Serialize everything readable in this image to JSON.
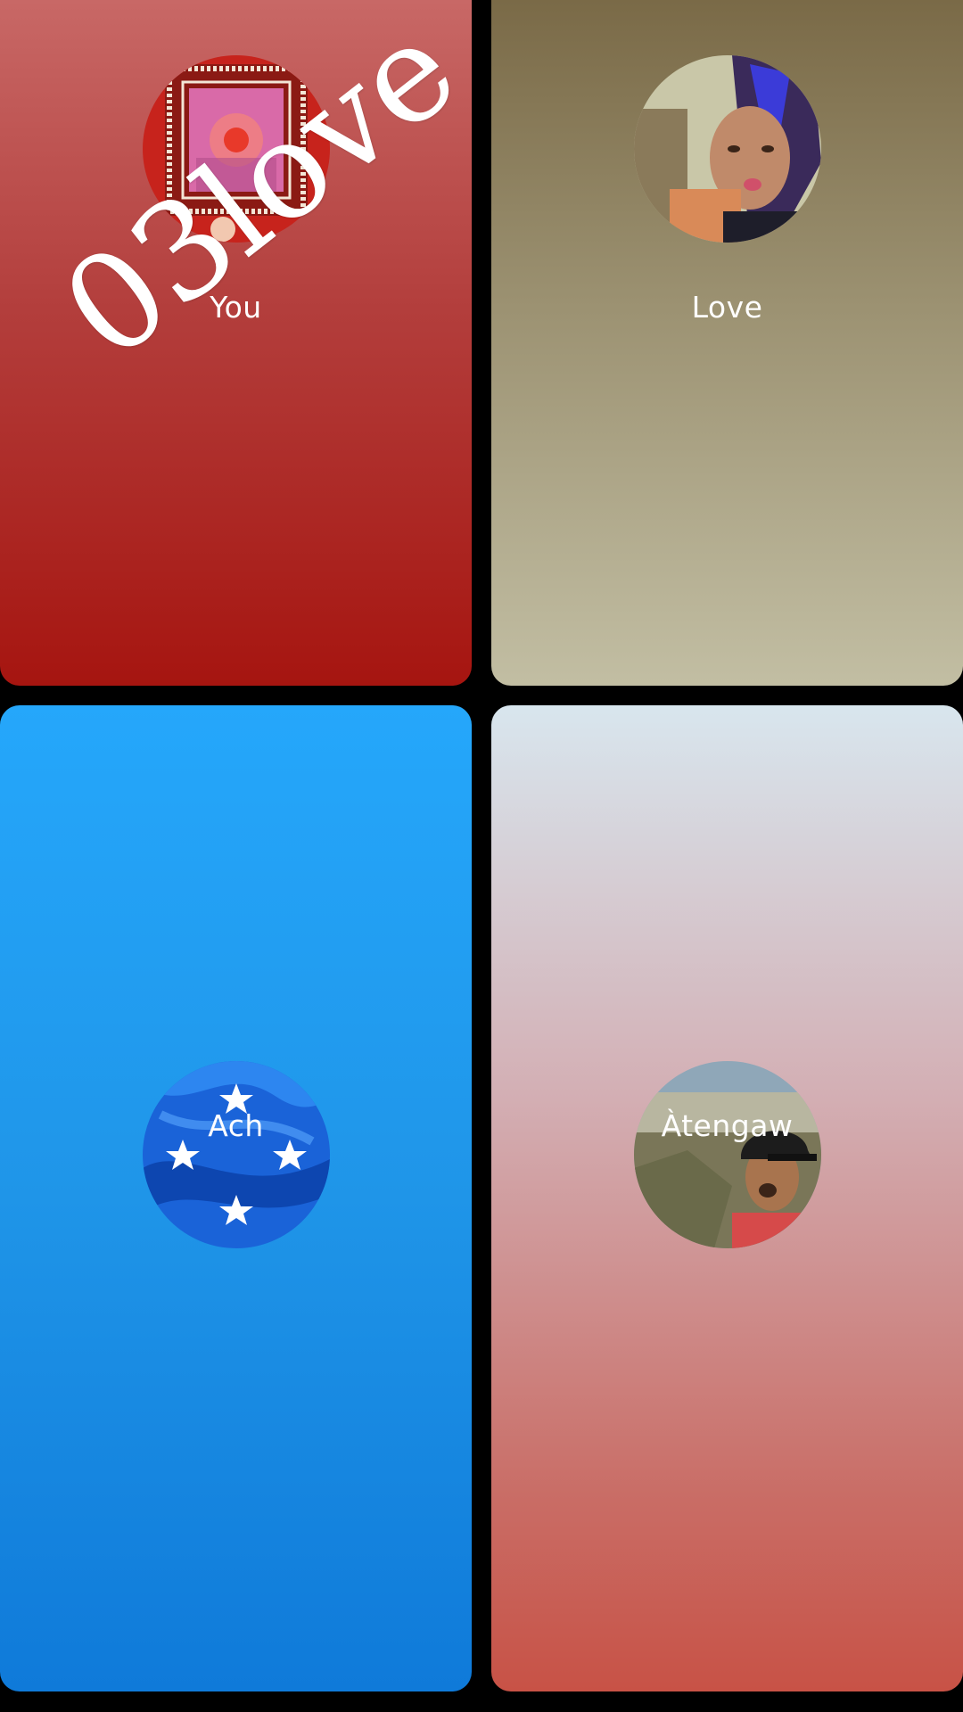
{
  "participants": [
    {
      "name": "You",
      "avatar_icon": "bandana-frame-photo"
    },
    {
      "name": "Love",
      "avatar_icon": "person-photo"
    },
    {
      "name": "Ach",
      "avatar_icon": "flag-with-stars"
    },
    {
      "name": "Àtengaw",
      "avatar_icon": "person-with-cap-photo"
    }
  ],
  "watermark": "03love",
  "colors": {
    "you_tile": "#a61510",
    "love_tile": "#9c9272",
    "ach_tile": "#1f95e8",
    "atengaw_tile": "#c96d66",
    "background": "#000000",
    "label_text": "#ffffff"
  }
}
